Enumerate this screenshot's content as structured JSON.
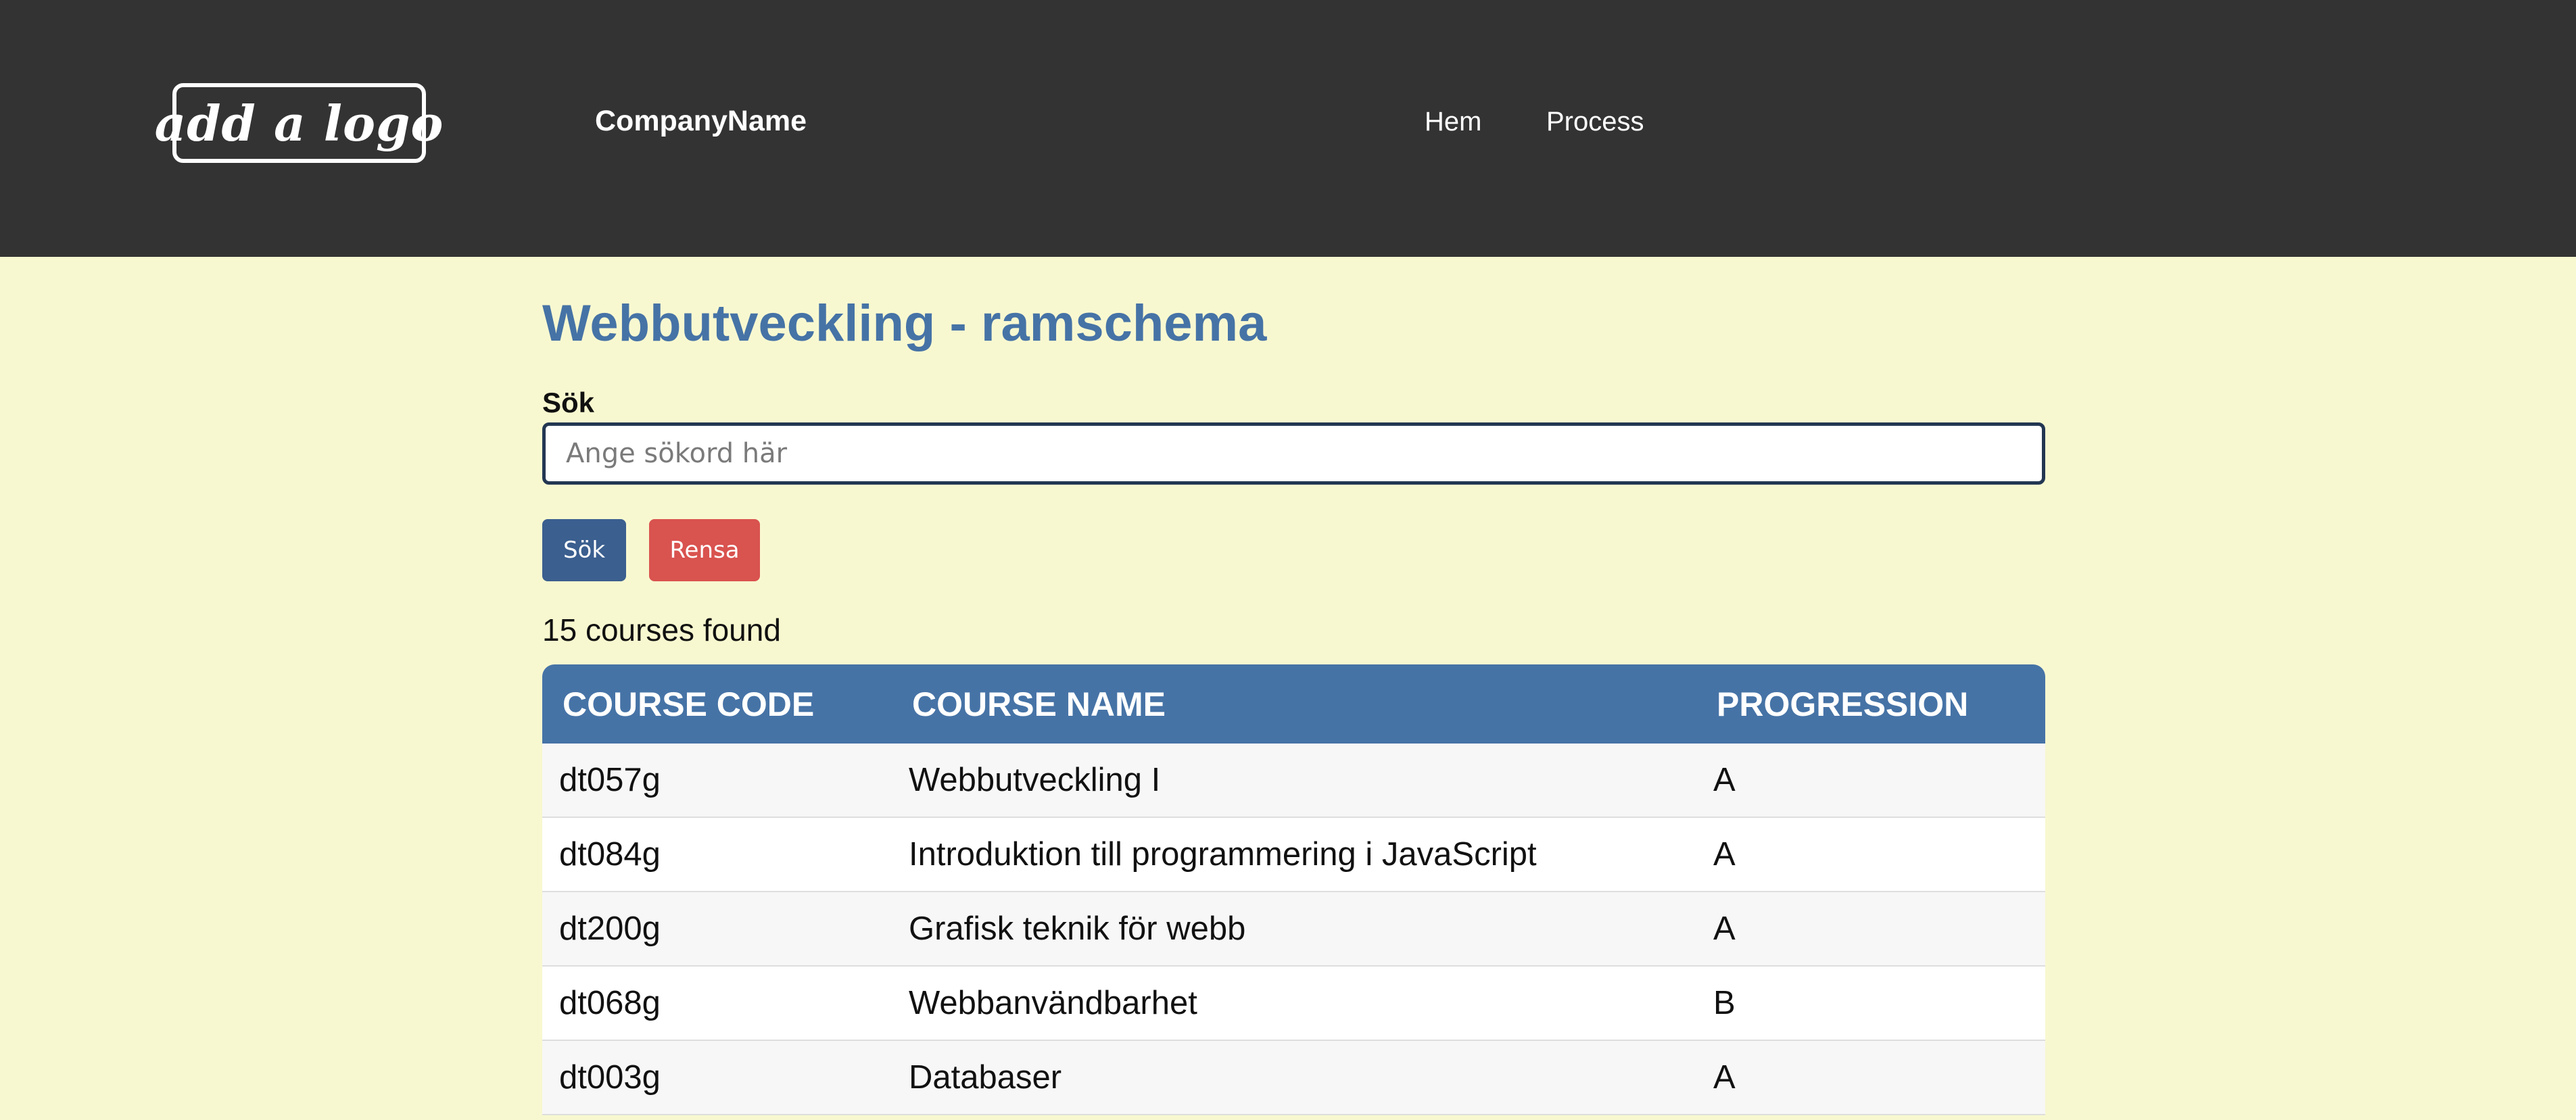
{
  "header": {
    "logo_text": "add a logo",
    "company_name": "CompanyName",
    "nav": [
      {
        "label": "Hem"
      },
      {
        "label": "Process"
      }
    ]
  },
  "main": {
    "title": "Webbutveckling - ramschema",
    "search": {
      "label": "Sök",
      "placeholder": "Ange sökord här",
      "value": "",
      "search_button": "Sök",
      "clear_button": "Rensa"
    },
    "result_count": "15 courses found",
    "table": {
      "columns": [
        "COURSE CODE",
        "COURSE NAME",
        "PROGRESSION"
      ],
      "rows": [
        [
          "dt057g",
          "Webbutveckling I",
          "A"
        ],
        [
          "dt084g",
          "Introduktion till programmering i JavaScript",
          "A"
        ],
        [
          "dt200g",
          "Grafisk teknik för webb",
          "A"
        ],
        [
          "dt068g",
          "Webbanvändbarhet",
          "B"
        ],
        [
          "dt003g",
          "Databaser",
          "A"
        ]
      ]
    }
  },
  "colors": {
    "header_bg": "#333333",
    "page_bg": "#f8f8d0",
    "accent": "#4673a6",
    "search_button": "#3b5f8f",
    "clear_button": "#d9534f"
  }
}
